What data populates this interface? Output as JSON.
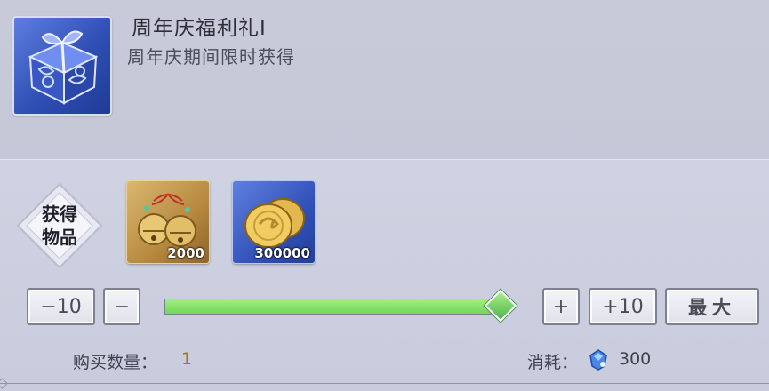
{
  "item": {
    "title": "周年庆福利礼Ⅰ",
    "subtitle": "周年庆期间限时获得",
    "icon": "gift-box-icon"
  },
  "rewards": {
    "badge_line1": "获得",
    "badge_line2": "物品",
    "items": [
      {
        "icon": "gold-bells-icon",
        "amount": "2000"
      },
      {
        "icon": "gold-coins-icon",
        "amount": "300000"
      }
    ]
  },
  "controls": {
    "minus10_label": "−10",
    "minus_label": "−",
    "plus_label": "+",
    "plus10_label": "+10",
    "max_label": "最大",
    "slider_fraction": 1.0
  },
  "purchase": {
    "quantity_label": "购买数量：",
    "quantity_value": "1",
    "cost_label": "消耗：",
    "cost_value": "300",
    "cost_icon": "blue-gem-icon"
  },
  "colors": {
    "slider_fill": "#7ddf62",
    "quantity_value": "#9a7a2a"
  }
}
